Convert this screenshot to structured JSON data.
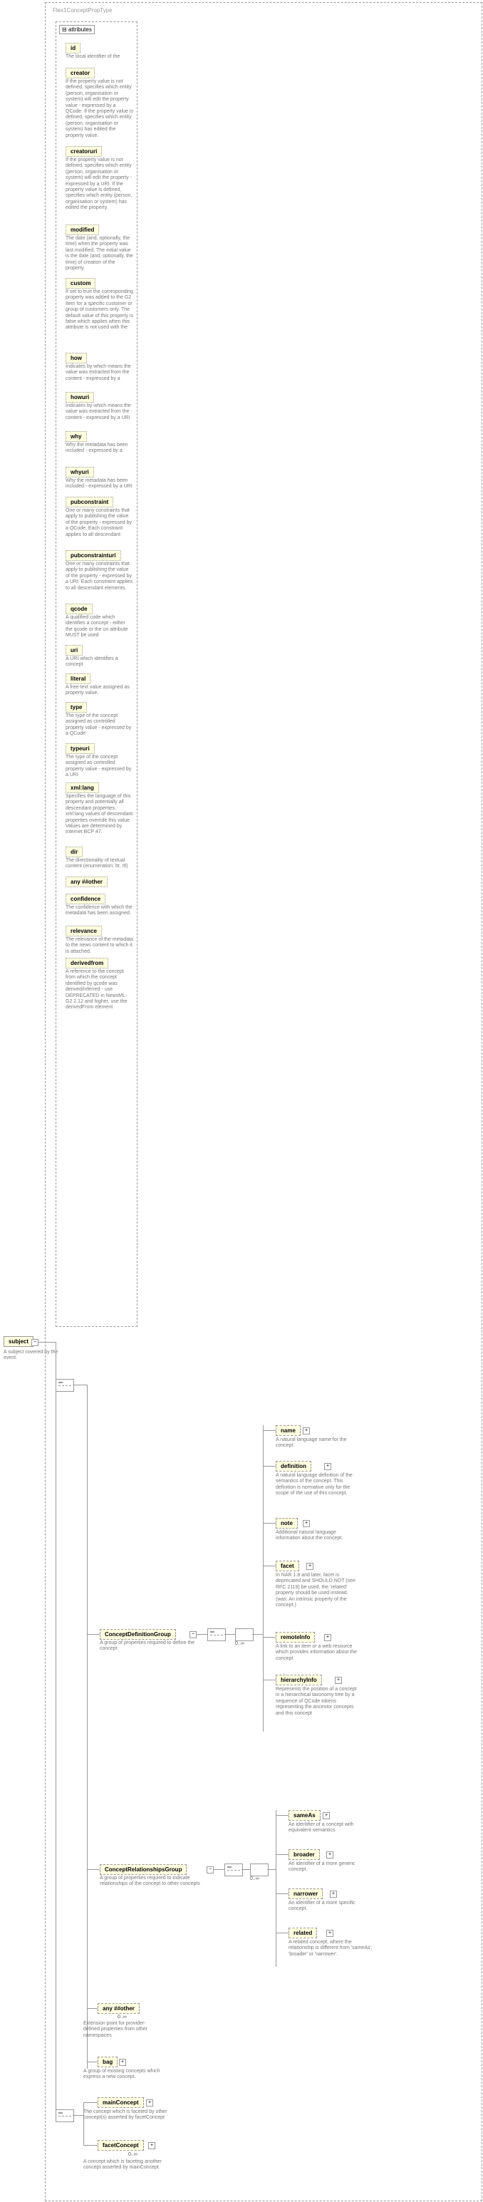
{
  "root": {
    "type_name": "Flex1ConceptPropType"
  },
  "subject": {
    "label": "subject",
    "desc": "A subject covered by the event."
  },
  "attributes_label": "attributes",
  "attrs": [
    {
      "name": "id",
      "desc": "The local identifier of the"
    },
    {
      "name": "creator",
      "desc": "If the property value is not defined, specifies which entity (person, organisation or system) will edit the property value - expressed by a QCode. If the property value is defined, specifies which entity (person, organisation or system) has edited the property value."
    },
    {
      "name": "creatoruri",
      "desc": "If the property value is not defined, specifies which entity (person, organisation or system) will edit the property - expressed by a URI. If the property value is defined, specifies which entity (person, organisation or system) has edited the property."
    },
    {
      "name": "modified",
      "desc": "The date (and, optionally, the time) when the property was last modified. The initial value is the date (and, optionally, the time) of creation of the property."
    },
    {
      "name": "custom",
      "desc": "If set to true the corresponding property was added to the G2 Item for a specific customer or group of customers only. The default value of this property is false which applies when this attribute is not used with the"
    },
    {
      "name": "how",
      "desc": "Indicates by which means the value was extracted from the content - expressed by a"
    },
    {
      "name": "howuri",
      "desc": "Indicates by which means the value was extracted from the content - expressed by a URI"
    },
    {
      "name": "why",
      "desc": "Why the metadata has been included - expressed by a"
    },
    {
      "name": "whyuri",
      "desc": "Why the metadata has been included - expressed by a URI"
    },
    {
      "name": "pubconstraint",
      "desc": "One or many constraints that apply to publishing the value of the property - expressed by a QCode. Each constraint applies to all descendant"
    },
    {
      "name": "pubconstrainturi",
      "desc": "One or many constraints that apply to publishing the value of the property - expressed by a URI. Each constraint applies to all descendant elements."
    },
    {
      "name": "qcode",
      "desc": "A qualified code which identifies a concept - either the qcode or the uri attribute MUST be used"
    },
    {
      "name": "uri",
      "desc": "A URI which identifies a concept"
    },
    {
      "name": "literal",
      "desc": "A free-text value assigned as property value."
    },
    {
      "name": "type",
      "desc": "The type of the concept assigned as controlled property value - expressed by a QCode"
    },
    {
      "name": "typeuri",
      "desc": "The type of the concept assigned as controlled property value - expressed by a URI"
    },
    {
      "name": "xml:lang",
      "desc": "Specifies the language of this property and potentially all descendant properties. xml:lang values of descendant properties override this value. Values are determined by Internet BCP 47."
    },
    {
      "name": "dir",
      "desc": "The directionality of textual content (enumeration: ltr, rtl)"
    },
    {
      "name": "any ##other",
      "desc": ""
    },
    {
      "name": "confidence",
      "desc": "The confidence with which the metadata has been assigned."
    },
    {
      "name": "relevance",
      "desc": "The relevance of the metadata to the news content to which it is attached."
    },
    {
      "name": "derivedfrom",
      "desc": "A reference to the concept from which the concept identified by qcode was derived/inferred - use DEPRECATED in NewsML-G2 2.12 and higher, use the derivedFrom element"
    }
  ],
  "cdg": {
    "label": "ConceptDefinitionGroup",
    "desc": "A group of properties required to define the concept",
    "mult": "0..∞"
  },
  "crg": {
    "label": "ConceptRelationshipsGroup",
    "desc": "A group of properties required to indicate relationships of the concept to other concepts",
    "mult": "0..∞"
  },
  "defs": [
    {
      "name": "name",
      "desc": "A natural language name for the concept."
    },
    {
      "name": "definition",
      "desc": "A natural language definition of the semantics of the concept. This definition is normative only for the scope of the use of this concept."
    },
    {
      "name": "note",
      "desc": "Additional natural language information about the concept."
    },
    {
      "name": "facet",
      "desc": "In NAR 1.8 and later, facet is deprecated and SHOULD NOT (see RFC 2119) be used, the 'related' property should be used instead. (was: An intrinsic property of the concept.)"
    },
    {
      "name": "remoteInfo",
      "desc": "A link to an item or a web resource which provides information about the concept"
    },
    {
      "name": "hierarchyInfo",
      "desc": "Represents the position of a concept in a hierarchical taxonomy tree by a sequence of QCode tokens representing the ancestor concepts and this concept"
    }
  ],
  "rels": [
    {
      "name": "sameAs",
      "desc": "An identifier of a concept with equivalent semantics"
    },
    {
      "name": "broader",
      "desc": "An identifier of a more generic concept."
    },
    {
      "name": "narrower",
      "desc": "An identifier of a more specific concept."
    },
    {
      "name": "related",
      "desc": "A related concept, where the relationship is different from 'sameAs', 'broader' or 'narrower'."
    }
  ],
  "bottom": {
    "any": {
      "label": "any ##other",
      "desc": "Extension point for provider-defined properties from other namespaces",
      "mult": "0..∞"
    },
    "bag": {
      "label": "bag",
      "desc": "A group of existing concepts which express a new concept."
    },
    "mainConcept": {
      "label": "mainConcept",
      "desc": "The concept which is faceted by other concept(s) asserted by facetConcept"
    },
    "facetConcept": {
      "label": "facetConcept",
      "desc": "A concept which is faceting another concept asserted by mainConcept",
      "mult": "0..∞"
    }
  }
}
